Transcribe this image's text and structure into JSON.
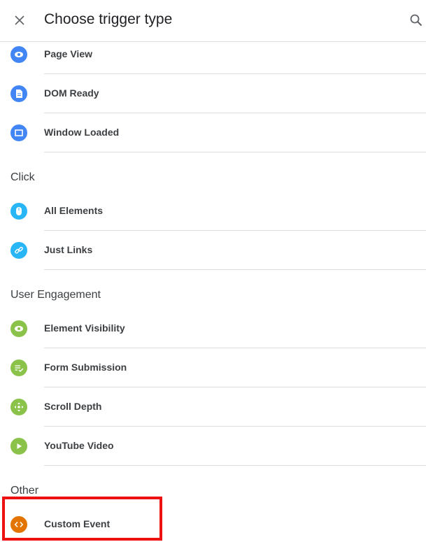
{
  "header": {
    "title": "Choose trigger type",
    "close_icon": "close-icon",
    "search_icon": "search-icon"
  },
  "sections": {
    "pageview": {
      "items": [
        {
          "label": "Page View",
          "icon": "eye-icon",
          "color": "#4285f4"
        },
        {
          "label": "DOM Ready",
          "icon": "document-icon",
          "color": "#4285f4"
        },
        {
          "label": "Window Loaded",
          "icon": "window-icon",
          "color": "#4285f4"
        }
      ]
    },
    "click": {
      "title": "Click",
      "items": [
        {
          "label": "All Elements",
          "icon": "mouse-icon",
          "color": "#29b6f6"
        },
        {
          "label": "Just Links",
          "icon": "link-icon",
          "color": "#29b6f6"
        }
      ]
    },
    "engagement": {
      "title": "User Engagement",
      "items": [
        {
          "label": "Element Visibility",
          "icon": "eye-icon",
          "color": "#8bc34a"
        },
        {
          "label": "Form Submission",
          "icon": "form-check-icon",
          "color": "#8bc34a"
        },
        {
          "label": "Scroll Depth",
          "icon": "move-icon",
          "color": "#8bc34a"
        },
        {
          "label": "YouTube Video",
          "icon": "play-icon",
          "color": "#8bc34a"
        }
      ]
    },
    "other": {
      "title": "Other",
      "items": [
        {
          "label": "Custom Event",
          "icon": "code-icon",
          "color": "#e37400"
        }
      ]
    }
  },
  "annotation": {
    "highlight_color": "#ee1111"
  }
}
